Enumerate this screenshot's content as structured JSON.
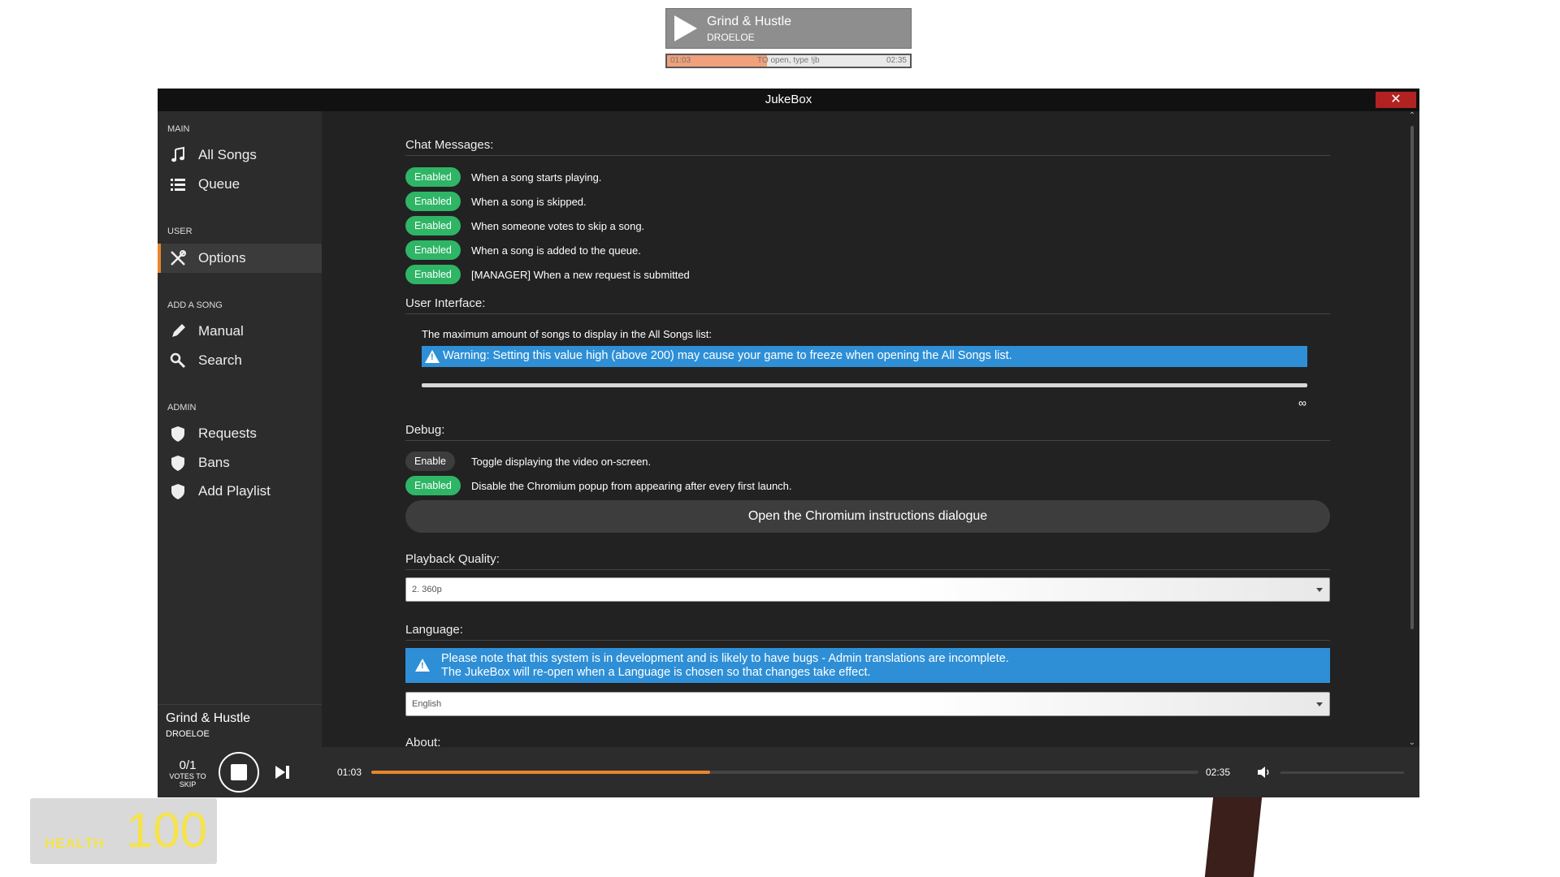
{
  "hud": {
    "title": "Grind & Hustle",
    "artist": "DROELOE",
    "time_current": "01:03",
    "hint": "TO open, type !jb",
    "time_total": "02:35",
    "progress": 0.41
  },
  "window": {
    "title": "JukeBox",
    "close_label": "✕"
  },
  "sidebar": {
    "sections": [
      {
        "head": "MAIN",
        "items": [
          {
            "label": "All Songs",
            "icon": "music-note-icon"
          },
          {
            "label": "Queue",
            "icon": "list-icon"
          }
        ]
      },
      {
        "head": "USER",
        "items": [
          {
            "label": "Options",
            "icon": "tools-icon",
            "active": true
          }
        ]
      },
      {
        "head": "ADD A SONG",
        "items": [
          {
            "label": "Manual",
            "icon": "pencil-icon"
          },
          {
            "label": "Search",
            "icon": "search-icon"
          }
        ]
      },
      {
        "head": "ADMIN",
        "items": [
          {
            "label": "Requests",
            "icon": "shield-icon"
          },
          {
            "label": "Bans",
            "icon": "shield-icon"
          },
          {
            "label": "Add Playlist",
            "icon": "shield-icon"
          }
        ]
      }
    ],
    "now_playing": {
      "title": "Grind & Hustle",
      "artist": "DROELOE"
    }
  },
  "content": {
    "chat": {
      "heading": "Chat Messages:",
      "options": [
        {
          "state": "Enabled",
          "text": "When a song starts playing."
        },
        {
          "state": "Enabled",
          "text": "When a song is skipped."
        },
        {
          "state": "Enabled",
          "text": "When someone votes to skip a song."
        },
        {
          "state": "Enabled",
          "text": "When a song is added to the queue."
        },
        {
          "state": "Enabled",
          "text": "[MANAGER] When a new request is submitted"
        }
      ]
    },
    "ui": {
      "heading": "User Interface:",
      "max_songs_label": "The maximum amount of songs to display in the All Songs list:",
      "warning": "Warning: Setting this value high (above 200) may cause your game to freeze when opening the All Songs list.",
      "slider_value": "∞"
    },
    "debug": {
      "heading": "Debug:",
      "options": [
        {
          "state": "Enable",
          "text": "Toggle displaying the video on-screen."
        },
        {
          "state": "Enabled",
          "text": "Disable the Chromium popup from appearing after every first launch."
        }
      ],
      "button": "Open the Chromium instructions dialogue"
    },
    "quality": {
      "heading": "Playback Quality:",
      "selected": "2. 360p"
    },
    "language": {
      "heading": "Language:",
      "note_line1": "Please note that this system is in development and is likely to have bugs - Admin translations are incomplete.",
      "note_line2": "The JukeBox will re-open when a Language is chosen so that changes take effect.",
      "selected": "English"
    },
    "about": {
      "heading": "About:"
    }
  },
  "player": {
    "votes": "0/1",
    "votes_label": "VOTES TO SKIP",
    "time_current": "01:03",
    "time_total": "02:35",
    "progress": 0.41,
    "volume": 0
  },
  "health": {
    "label": "HEALTH",
    "value": "100"
  },
  "colors": {
    "accent": "#e8862b",
    "enabled": "#2fb566",
    "info": "#2e8fd6",
    "close": "#b22222"
  }
}
